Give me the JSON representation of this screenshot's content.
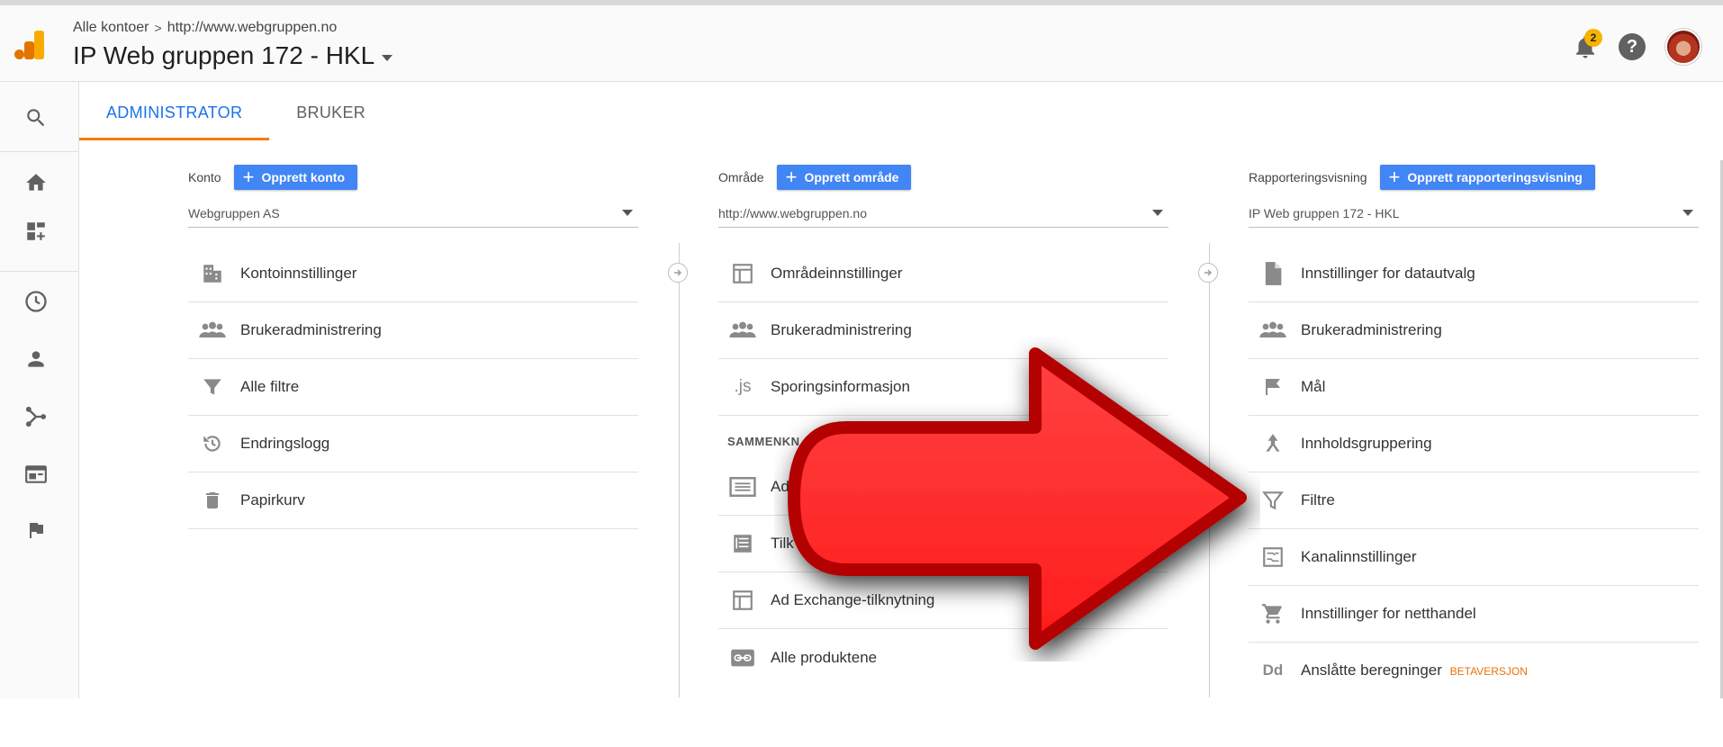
{
  "header": {
    "breadcrumb_root": "Alle kontoer",
    "breadcrumb_sep": ">",
    "breadcrumb_property": "http://www.webgruppen.no",
    "view_title": "IP Web gruppen 172 - HKL",
    "notification_count": "2",
    "help_label": "?"
  },
  "tabs": [
    {
      "label": "ADMINISTRATOR"
    },
    {
      "label": "BRUKER"
    }
  ],
  "account": {
    "label": "Konto",
    "create_button": "Opprett konto",
    "selected": "Webgruppen AS",
    "items": [
      {
        "label": "Kontoinnstillinger",
        "icon": "building-icon"
      },
      {
        "label": "Brukeradministrering",
        "icon": "people-icon"
      },
      {
        "label": "Alle filtre",
        "icon": "filter-icon"
      },
      {
        "label": "Endringslogg",
        "icon": "history-icon"
      },
      {
        "label": "Papirkurv",
        "icon": "trash-icon"
      }
    ]
  },
  "property": {
    "label": "Område",
    "create_button": "Opprett område",
    "selected": "http://www.webgruppen.no",
    "items": [
      {
        "label": "Områdeinnstillinger",
        "icon": "layout-icon"
      },
      {
        "label": "Brukeradministrering",
        "icon": "people-icon"
      },
      {
        "label": "Sporingsinformasjon",
        "icon": "js-icon",
        "icon_text": ".js"
      }
    ],
    "section_heading": "SAMMENKN",
    "linked_items": [
      {
        "label": "Ad",
        "icon": "ad-icon"
      },
      {
        "label": "Tilk",
        "icon": "list-icon"
      },
      {
        "label": "Ad Exchange-tilknytning",
        "icon": "layout-icon"
      },
      {
        "label": "Alle produktene",
        "icon": "link-icon"
      }
    ]
  },
  "view": {
    "label": "Rapporteringsvisning",
    "create_button": "Opprett rapporteringsvisning",
    "selected": "IP Web gruppen 172 - HKL",
    "items": [
      {
        "label": "Innstillinger for datautvalg",
        "icon": "document-icon"
      },
      {
        "label": "Brukeradministrering",
        "icon": "people-icon"
      },
      {
        "label": "Mål",
        "icon": "flag-icon"
      },
      {
        "label": "Innholdsgruppering",
        "icon": "grouping-icon"
      },
      {
        "label": "Filtre",
        "icon": "filter-icon"
      },
      {
        "label": "Kanalinnstillinger",
        "icon": "channel-icon"
      },
      {
        "label": "Innstillinger for netthandel",
        "icon": "cart-icon"
      },
      {
        "label": "Anslåtte beregninger",
        "icon": "dd-icon",
        "icon_text": "Dd",
        "badge": "BETAVERSJON"
      }
    ]
  },
  "colors": {
    "accent_blue": "#4285f4",
    "tab_active": "#1a73e8",
    "tab_underline": "#f57c00",
    "arrow_red": "#ff2a2a",
    "beta_orange": "#e8710a"
  }
}
